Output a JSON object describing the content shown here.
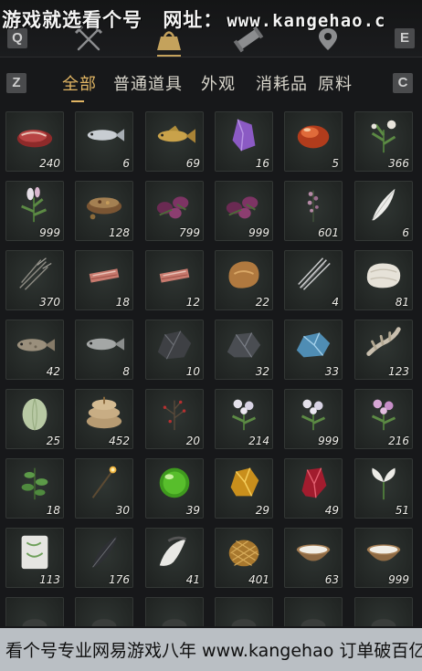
{
  "watermark_top": {
    "text": "游戏就选看个号",
    "label": "网址：",
    "url": "www.kangehao.c"
  },
  "keys": {
    "prev_category": "Q",
    "next_category": "E",
    "prev_tab": "Z",
    "next_tab": "C"
  },
  "top_categories": [
    {
      "icon": "crossed-swords-icon",
      "active": false
    },
    {
      "icon": "bag-icon",
      "active": true
    },
    {
      "icon": "scroll-icon",
      "active": false
    },
    {
      "icon": "location-icon",
      "active": false
    }
  ],
  "tabs": [
    {
      "label": "全部",
      "active": true
    },
    {
      "label": "普通道具",
      "active": false
    },
    {
      "label": "外观",
      "active": false
    },
    {
      "label": "消耗品",
      "active": false
    },
    {
      "label": "原料",
      "active": false
    }
  ],
  "colors": {
    "accent": "#e1b563",
    "background": "#17181a",
    "slot": "#262a28"
  },
  "items": [
    {
      "icon": "raw-meat-icon",
      "qty": "240"
    },
    {
      "icon": "silver-fish-icon",
      "qty": "6"
    },
    {
      "icon": "golden-carp-icon",
      "qty": "69"
    },
    {
      "icon": "amethyst-icon",
      "qty": "16"
    },
    {
      "icon": "red-agate-icon",
      "qty": "5"
    },
    {
      "icon": "white-flower-herb-icon",
      "qty": "366"
    },
    {
      "icon": "pink-flower-herb-icon",
      "qty": "999"
    },
    {
      "icon": "spice-bowl-icon",
      "qty": "128"
    },
    {
      "icon": "purple-blossom-icon",
      "qty": "799"
    },
    {
      "icon": "purple-blossom-icon",
      "qty": "999"
    },
    {
      "icon": "dark-flower-stalk-icon",
      "qty": "601"
    },
    {
      "icon": "white-feather-icon",
      "qty": "6"
    },
    {
      "icon": "dry-grass-icon",
      "qty": "370"
    },
    {
      "icon": "meat-slices-icon",
      "qty": "18"
    },
    {
      "icon": "meat-slices-icon",
      "qty": "12"
    },
    {
      "icon": "brown-fur-icon",
      "qty": "22"
    },
    {
      "icon": "quills-icon",
      "qty": "4"
    },
    {
      "icon": "white-fur-icon",
      "qty": "81"
    },
    {
      "icon": "grouper-fish-icon",
      "qty": "42"
    },
    {
      "icon": "grey-fish-icon",
      "qty": "8"
    },
    {
      "icon": "black-ore-icon",
      "qty": "10"
    },
    {
      "icon": "dark-ore-icon",
      "qty": "32"
    },
    {
      "icon": "blue-ore-icon",
      "qty": "33"
    },
    {
      "icon": "bone-icon",
      "qty": "123"
    },
    {
      "icon": "melon-icon",
      "qty": "25"
    },
    {
      "icon": "grain-sacks-icon",
      "qty": "452"
    },
    {
      "icon": "red-berry-bush-icon",
      "qty": "20"
    },
    {
      "icon": "white-flower-icon",
      "qty": "214"
    },
    {
      "icon": "white-flower-icon",
      "qty": "999"
    },
    {
      "icon": "pink-flower-icon",
      "qty": "216"
    },
    {
      "icon": "mint-herb-icon",
      "qty": "18"
    },
    {
      "icon": "torch-stick-icon",
      "qty": "30"
    },
    {
      "icon": "jade-orb-icon",
      "qty": "39"
    },
    {
      "icon": "gold-nugget-icon",
      "qty": "29"
    },
    {
      "icon": "red-crystal-icon",
      "qty": "49"
    },
    {
      "icon": "white-lily-icon",
      "qty": "51"
    },
    {
      "icon": "porcelain-tile-icon",
      "qty": "113"
    },
    {
      "icon": "black-feather-icon",
      "qty": "176"
    },
    {
      "icon": "white-tuft-icon",
      "qty": "41"
    },
    {
      "icon": "woven-gold-icon",
      "qty": "401"
    },
    {
      "icon": "milk-bowl-icon",
      "qty": "63"
    },
    {
      "icon": "milk-bowl-icon",
      "qty": "999"
    },
    {
      "icon": "unknown-icon",
      "qty": ""
    },
    {
      "icon": "unknown-icon",
      "qty": ""
    },
    {
      "icon": "unknown-icon",
      "qty": ""
    },
    {
      "icon": "unknown-icon",
      "qty": ""
    },
    {
      "icon": "unknown-icon",
      "qty": ""
    },
    {
      "icon": "unknown-icon",
      "qty": ""
    }
  ],
  "watermark_bottom": {
    "text": "看个号专业网易游戏八年 www.kangehao 订单破百亿"
  }
}
